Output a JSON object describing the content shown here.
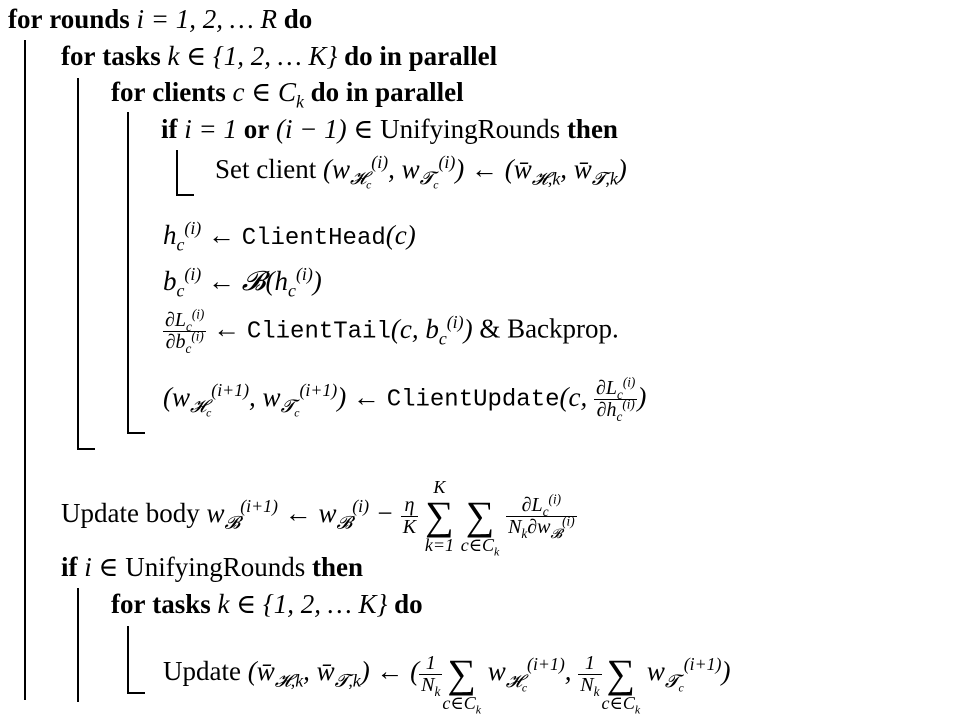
{
  "algorithm": {
    "l1": {
      "kw_for": "for",
      "kw_rounds": "rounds",
      "cond": "i = 1, 2, … R",
      "kw_do": "do"
    },
    "l2": {
      "kw_for": "for",
      "kw_tasks": "tasks",
      "cond": "k ∈ {1, 2, … K}",
      "kw_do": "do in parallel"
    },
    "l3": {
      "kw_for": "for",
      "kw_clients": "clients",
      "cond": "c ∈ C",
      "cond_sub": "k",
      "kw_do": "do in parallel"
    },
    "l4": {
      "kw_if": "if",
      "cond_a": "i = 1",
      "kw_or": "or",
      "cond_b": "(i − 1) ∈",
      "set": "UnifyingRounds",
      "kw_then": "then"
    },
    "l5": {
      "text": "Set client"
    },
    "l6": {
      "func": "ClientHead"
    },
    "l7": {
      "func": "𝓑"
    },
    "l8": {
      "func": "ClientTail",
      "suffix": "& Backprop."
    },
    "l9": {
      "func": "ClientUpdate"
    },
    "l10": {
      "text": "Update body"
    },
    "l11": {
      "kw_if": "if",
      "cond": "i ∈",
      "set": "UnifyingRounds",
      "kw_then": "then"
    },
    "l12": {
      "kw_for": "for",
      "kw_tasks": "tasks",
      "cond": "k ∈ {1, 2, … K}",
      "kw_do": "do"
    },
    "l13": {
      "text": "Update"
    }
  }
}
